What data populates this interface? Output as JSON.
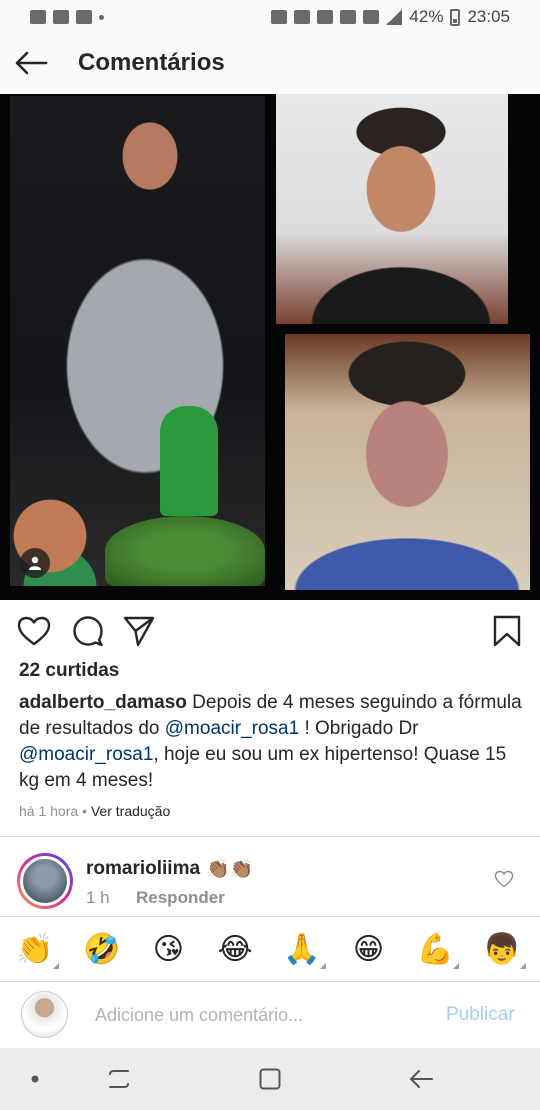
{
  "status_bar": {
    "battery": "42%",
    "time": "23:05"
  },
  "header": {
    "title": "Comentários",
    "back_icon": "arrow-left-icon"
  },
  "post": {
    "likes": "22 curtidas",
    "username": "adalberto_damaso",
    "caption_parts": {
      "part1": " Depois de 4 meses seguindo a fórmula de resultados do ",
      "mention1": "@moacir_rosa1",
      "part2": " ! Obrigado Dr ",
      "mention2": "@moacir_rosa1",
      "part3": ", hoje eu sou um ex hipertenso! Quase 15 kg em 4 meses!"
    },
    "time_ago": "há 1 hora",
    "separator": " • ",
    "translate": "Ver tradução",
    "icons": [
      "heart-icon",
      "comment-icon",
      "share-icon",
      "bookmark-icon"
    ]
  },
  "comment": {
    "username": "romarioliima",
    "text": "👏🏽👏🏽",
    "time": "1 h",
    "reply": "Responder"
  },
  "emoji_bar": [
    "👏",
    "🤣",
    "😘",
    "😂",
    "🙏",
    "😁",
    "💪",
    "👦"
  ],
  "composer": {
    "placeholder": "Adicione um comentário...",
    "publish": "Publicar"
  },
  "colors": {
    "link": "#003569",
    "publish_disabled": "#a6cdf5",
    "muted": "#8e8e8e"
  }
}
